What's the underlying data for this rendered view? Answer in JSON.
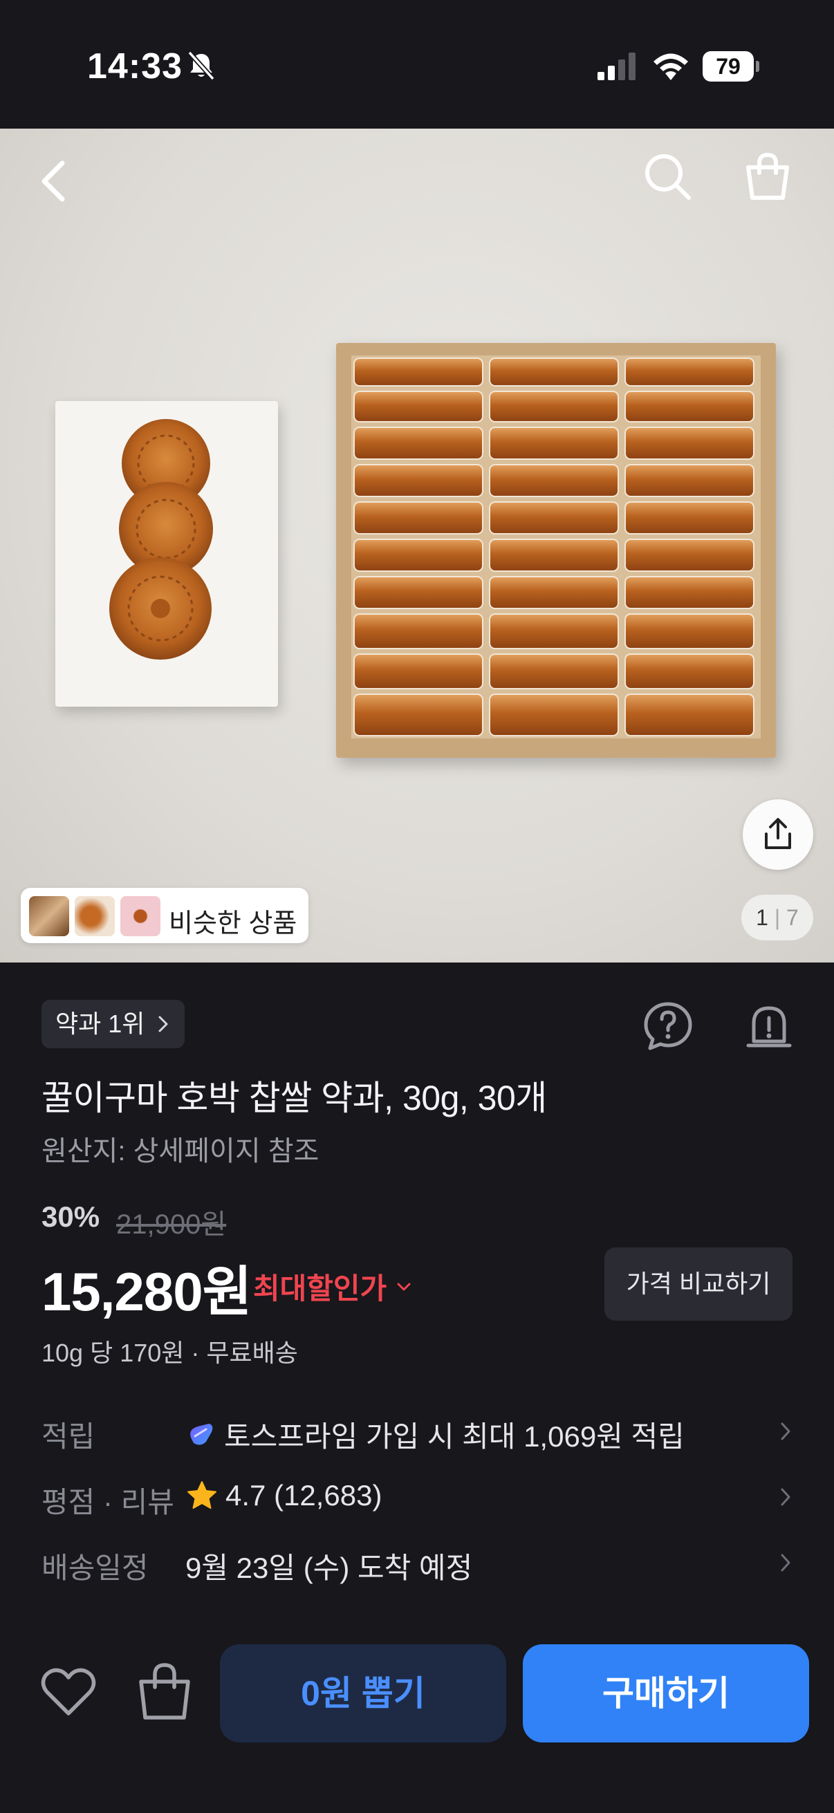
{
  "status_bar": {
    "time": "14:33",
    "battery": "79",
    "icons": [
      "bell-slash-icon",
      "cellular-signal-icon",
      "wifi-icon",
      "battery-icon"
    ]
  },
  "header": {
    "icons": [
      "back-arrow-icon",
      "search-icon",
      "shopping-bag-icon"
    ]
  },
  "gallery": {
    "current": "1",
    "total": "7",
    "similar_label": "비슷한 상품",
    "share_icon": "share-icon"
  },
  "product": {
    "rank_badge": "약과 1위",
    "title": "꿀이구마 호박 찹쌀 약과, 30g, 30개",
    "origin": "원산지: 상세페이지 참조",
    "discount_rate": "30%",
    "original_price": "21,900원",
    "price": "15,280원",
    "max_discount_label": "최대할인가",
    "compare_button": "가격 비교하기",
    "unit_price": "10g 당 170원 · 무료배송"
  },
  "info_rows": [
    {
      "label": "적립",
      "value": "토스프라임 가입 시 최대 1,069원 적립",
      "icon": "toss-prime-gem-icon"
    },
    {
      "label": "평점 · 리뷰",
      "value": "4.7 (12,683)",
      "icon": "star-icon"
    },
    {
      "label": "배송일정",
      "value": "9월 23일 (수) 도착 예정"
    }
  ],
  "bottom_bar": {
    "draw_button": "0원 뽑기",
    "buy_button": "구매하기",
    "icons": [
      "heart-icon",
      "shopping-bag-icon"
    ]
  },
  "colors": {
    "background": "#17171c",
    "accent_blue": "#3182f6",
    "discount_red": "#f0454f",
    "star": "#f9b51b"
  }
}
